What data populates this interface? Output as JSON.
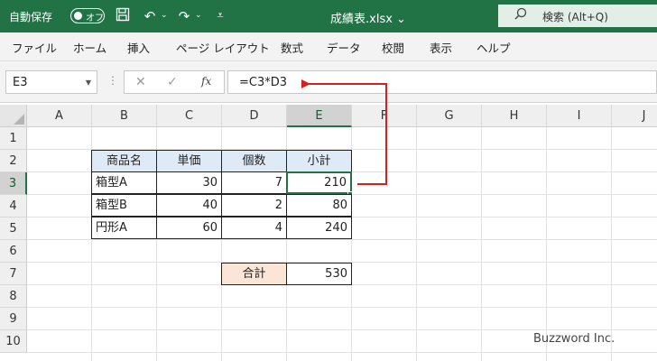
{
  "titlebar": {
    "autosave_label": "自動保存",
    "autosave_state": "オフ",
    "filename": "成績表.xlsx",
    "filename_caret": "⌄",
    "search_label": "検索 (Alt+Q)"
  },
  "ribbon": {
    "tabs": [
      "ファイル",
      "ホーム",
      "挿入",
      "ページ レイアウト",
      "数式",
      "データ",
      "校閲",
      "表示",
      "ヘルプ"
    ]
  },
  "formulabar": {
    "namebox": "E3",
    "formula": "=C3*D3"
  },
  "grid": {
    "columns": [
      "A",
      "B",
      "C",
      "D",
      "E",
      "F",
      "G",
      "H",
      "I",
      "J"
    ],
    "rows": [
      "1",
      "2",
      "3",
      "4",
      "5",
      "6",
      "7",
      "8",
      "9",
      "10"
    ],
    "selected_column": "E",
    "selected_row": "3"
  },
  "table": {
    "headers": [
      "商品名",
      "単価",
      "個数",
      "小計"
    ],
    "rows": [
      {
        "name": "箱型A",
        "price": "30",
        "qty": "7",
        "subtotal": "210"
      },
      {
        "name": "箱型B",
        "price": "40",
        "qty": "2",
        "subtotal": "80"
      },
      {
        "name": "円形A",
        "price": "60",
        "qty": "4",
        "subtotal": "240"
      }
    ],
    "total_label": "合計",
    "total_value": "530"
  },
  "colors": {
    "accent": "#217346",
    "header_fill": "#deebf7",
    "total_fill": "#fbe5d6",
    "arrow": "#d42020"
  },
  "watermark": "Buzzword Inc."
}
